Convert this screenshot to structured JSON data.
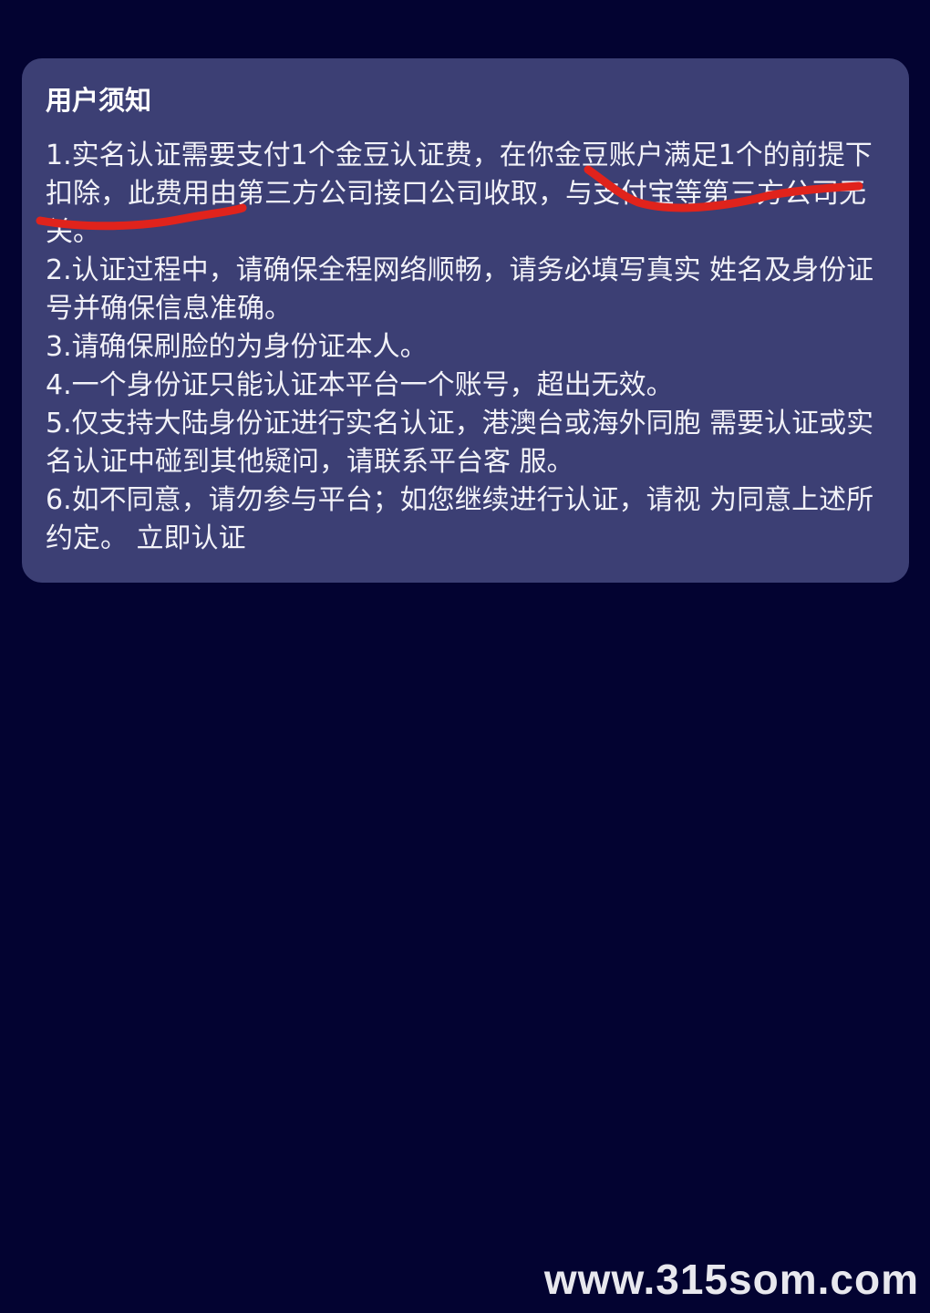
{
  "dialog": {
    "title": "用户须知",
    "items": [
      "1.实名认证需要支付1个金豆认证费，在你金豆账户满足1个的前提下扣除，此费用由第三方公司接口公司收取，与支付宝等第三方公司无关。",
      "2.认证过程中，请确保全程网络顺畅，请务必填写真实 姓名及身份证号并确保信息准确。",
      "3.请确保刷脸的为身份证本人。",
      "4.一个身份证只能认证本平台一个账号，超出无效。",
      "5.仅支持大陆身份证进行实名认证，港澳台或海外同胞 需要认证或实名认证中碰到其他疑问，请联系平台客 服。"
    ],
    "item6_text": "6.如不同意，请勿参与平台；如您继续进行认证，请视 为同意上述所约定。",
    "verify_label": "立即认证"
  },
  "annotation_color": "#e0231c",
  "watermark": "www.315som.com"
}
